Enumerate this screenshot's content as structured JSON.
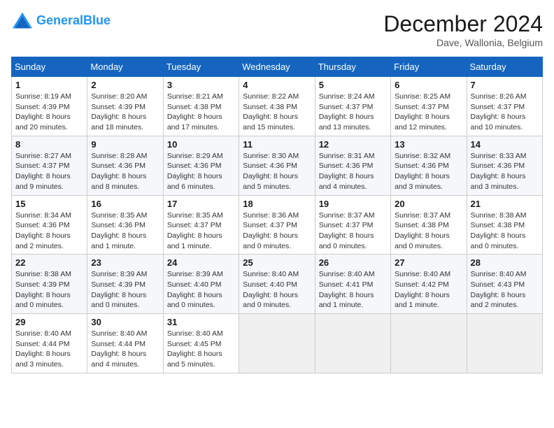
{
  "header": {
    "logo_general": "General",
    "logo_blue": "Blue",
    "month_title": "December 2024",
    "location": "Dave, Wallonia, Belgium"
  },
  "calendar": {
    "days_of_week": [
      "Sunday",
      "Monday",
      "Tuesday",
      "Wednesday",
      "Thursday",
      "Friday",
      "Saturday"
    ],
    "weeks": [
      [
        {
          "day": "1",
          "info": "Sunrise: 8:19 AM\nSunset: 4:39 PM\nDaylight: 8 hours and 20 minutes."
        },
        {
          "day": "2",
          "info": "Sunrise: 8:20 AM\nSunset: 4:39 PM\nDaylight: 8 hours and 18 minutes."
        },
        {
          "day": "3",
          "info": "Sunrise: 8:21 AM\nSunset: 4:38 PM\nDaylight: 8 hours and 17 minutes."
        },
        {
          "day": "4",
          "info": "Sunrise: 8:22 AM\nSunset: 4:38 PM\nDaylight: 8 hours and 15 minutes."
        },
        {
          "day": "5",
          "info": "Sunrise: 8:24 AM\nSunset: 4:37 PM\nDaylight: 8 hours and 13 minutes."
        },
        {
          "day": "6",
          "info": "Sunrise: 8:25 AM\nSunset: 4:37 PM\nDaylight: 8 hours and 12 minutes."
        },
        {
          "day": "7",
          "info": "Sunrise: 8:26 AM\nSunset: 4:37 PM\nDaylight: 8 hours and 10 minutes."
        }
      ],
      [
        {
          "day": "8",
          "info": "Sunrise: 8:27 AM\nSunset: 4:37 PM\nDaylight: 8 hours and 9 minutes."
        },
        {
          "day": "9",
          "info": "Sunrise: 8:28 AM\nSunset: 4:36 PM\nDaylight: 8 hours and 8 minutes."
        },
        {
          "day": "10",
          "info": "Sunrise: 8:29 AM\nSunset: 4:36 PM\nDaylight: 8 hours and 6 minutes."
        },
        {
          "day": "11",
          "info": "Sunrise: 8:30 AM\nSunset: 4:36 PM\nDaylight: 8 hours and 5 minutes."
        },
        {
          "day": "12",
          "info": "Sunrise: 8:31 AM\nSunset: 4:36 PM\nDaylight: 8 hours and 4 minutes."
        },
        {
          "day": "13",
          "info": "Sunrise: 8:32 AM\nSunset: 4:36 PM\nDaylight: 8 hours and 3 minutes."
        },
        {
          "day": "14",
          "info": "Sunrise: 8:33 AM\nSunset: 4:36 PM\nDaylight: 8 hours and 3 minutes."
        }
      ],
      [
        {
          "day": "15",
          "info": "Sunrise: 8:34 AM\nSunset: 4:36 PM\nDaylight: 8 hours and 2 minutes."
        },
        {
          "day": "16",
          "info": "Sunrise: 8:35 AM\nSunset: 4:36 PM\nDaylight: 8 hours and 1 minute."
        },
        {
          "day": "17",
          "info": "Sunrise: 8:35 AM\nSunset: 4:37 PM\nDaylight: 8 hours and 1 minute."
        },
        {
          "day": "18",
          "info": "Sunrise: 8:36 AM\nSunset: 4:37 PM\nDaylight: 8 hours and 0 minutes."
        },
        {
          "day": "19",
          "info": "Sunrise: 8:37 AM\nSunset: 4:37 PM\nDaylight: 8 hours and 0 minutes."
        },
        {
          "day": "20",
          "info": "Sunrise: 8:37 AM\nSunset: 4:38 PM\nDaylight: 8 hours and 0 minutes."
        },
        {
          "day": "21",
          "info": "Sunrise: 8:38 AM\nSunset: 4:38 PM\nDaylight: 8 hours and 0 minutes."
        }
      ],
      [
        {
          "day": "22",
          "info": "Sunrise: 8:38 AM\nSunset: 4:39 PM\nDaylight: 8 hours and 0 minutes."
        },
        {
          "day": "23",
          "info": "Sunrise: 8:39 AM\nSunset: 4:39 PM\nDaylight: 8 hours and 0 minutes."
        },
        {
          "day": "24",
          "info": "Sunrise: 8:39 AM\nSunset: 4:40 PM\nDaylight: 8 hours and 0 minutes."
        },
        {
          "day": "25",
          "info": "Sunrise: 8:40 AM\nSunset: 4:40 PM\nDaylight: 8 hours and 0 minutes."
        },
        {
          "day": "26",
          "info": "Sunrise: 8:40 AM\nSunset: 4:41 PM\nDaylight: 8 hours and 1 minute."
        },
        {
          "day": "27",
          "info": "Sunrise: 8:40 AM\nSunset: 4:42 PM\nDaylight: 8 hours and 1 minute."
        },
        {
          "day": "28",
          "info": "Sunrise: 8:40 AM\nSunset: 4:43 PM\nDaylight: 8 hours and 2 minutes."
        }
      ],
      [
        {
          "day": "29",
          "info": "Sunrise: 8:40 AM\nSunset: 4:44 PM\nDaylight: 8 hours and 3 minutes."
        },
        {
          "day": "30",
          "info": "Sunrise: 8:40 AM\nSunset: 4:44 PM\nDaylight: 8 hours and 4 minutes."
        },
        {
          "day": "31",
          "info": "Sunrise: 8:40 AM\nSunset: 4:45 PM\nDaylight: 8 hours and 5 minutes."
        },
        {
          "day": "",
          "info": ""
        },
        {
          "day": "",
          "info": ""
        },
        {
          "day": "",
          "info": ""
        },
        {
          "day": "",
          "info": ""
        }
      ]
    ]
  }
}
